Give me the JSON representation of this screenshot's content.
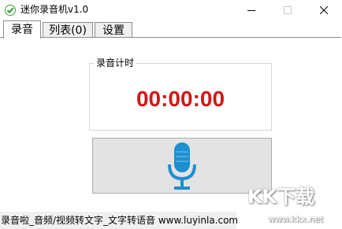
{
  "window": {
    "title": "迷你录音机v1.0",
    "icon": "green-check-icon"
  },
  "tabs": [
    {
      "label": "录音",
      "active": true
    },
    {
      "label": "列表(0)",
      "active": false
    },
    {
      "label": "设置",
      "active": false
    }
  ],
  "record_panel": {
    "group_label": "录音计时",
    "timer": "00:00:00",
    "timer_color": "#d01818",
    "mic_icon": "microphone-icon",
    "mic_color": "#1e8fd0"
  },
  "status_bar": {
    "text": "录音啦_音频/视频转文字_文字转语音 www.luyinla.com"
  },
  "watermark": {
    "main": "KK下载",
    "sub": "www.kkx.net"
  }
}
